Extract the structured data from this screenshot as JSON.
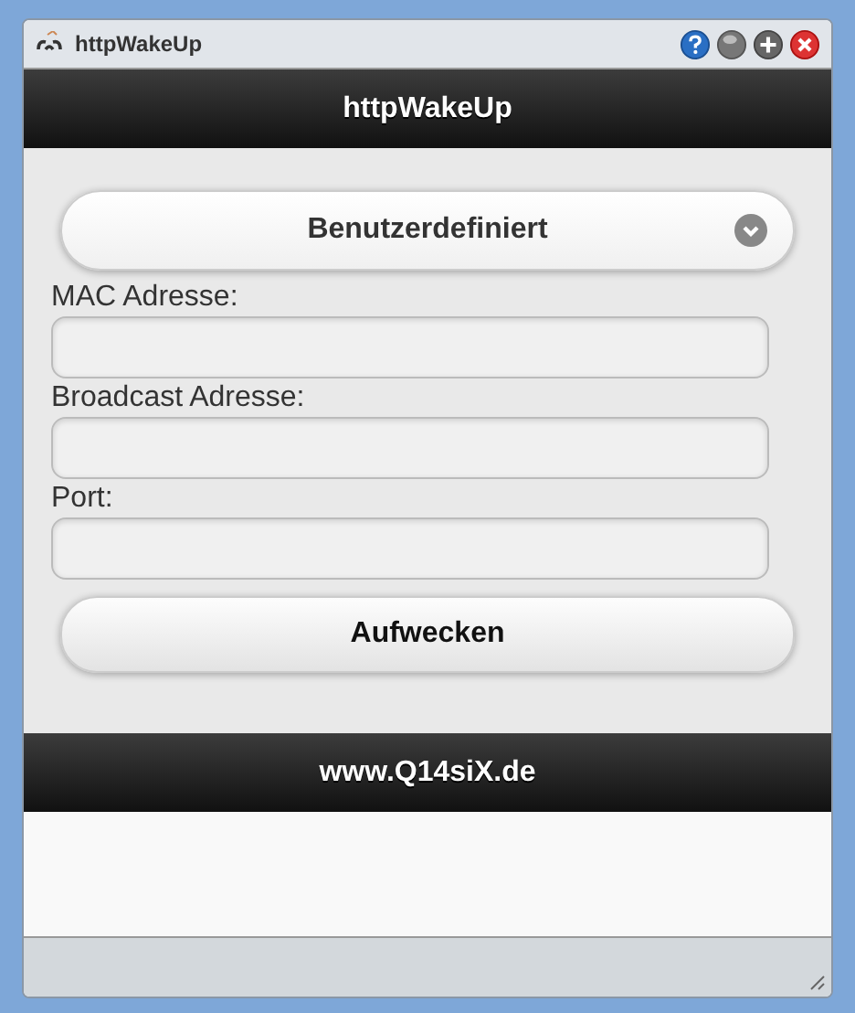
{
  "window": {
    "title": "httpWakeUp"
  },
  "header": {
    "title": "httpWakeUp"
  },
  "preset_select": {
    "value": "Benutzerdefiniert"
  },
  "fields": [
    {
      "label": "MAC Adresse:"
    },
    {
      "label": "Broadcast Adresse:"
    },
    {
      "label": "Port:"
    }
  ],
  "wake_button": {
    "label": "Aufwecken"
  },
  "footer": {
    "text": "www.Q14siX.de"
  }
}
